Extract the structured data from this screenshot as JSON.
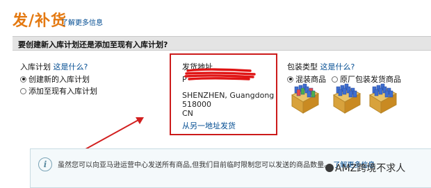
{
  "page": {
    "title": "发/补货",
    "learn_more_link": "了解更多信息",
    "question_header": "要创建新入库计划还是添加至现有入库计划?"
  },
  "inbound_plan": {
    "label": "入库计划",
    "help_link": "这是什么?",
    "options": [
      {
        "label": "创建新的入库计划",
        "selected": true
      },
      {
        "label": "添加至现有入库计划",
        "selected": false
      }
    ]
  },
  "ship_from": {
    "label": "发货地址",
    "name_first_char": "P",
    "address_lines": [
      "SHENZHEN, Guangdong",
      "518000",
      "CN"
    ],
    "change_link": "从另一地址发货"
  },
  "packing_type": {
    "label": "包装类型",
    "help_link": "这是什么?",
    "options": [
      {
        "label": "混装商品",
        "selected": true
      },
      {
        "label": "原厂包装发货商品",
        "selected": false
      }
    ]
  },
  "info_banner": {
    "text": "虽然您可以向亚马逊运营中心发送所有商品,但我们目前临时限制您可以发送的商品数量。",
    "link": "了解更多信息"
  },
  "watermark": {
    "text": "AMZ跨境不求人"
  },
  "colors": {
    "title_orange": "#e47911",
    "link_blue": "#004b91",
    "highlight_red": "#cc1a1a",
    "arrow_red": "#d21f1f",
    "header_gray": "#e4e4e4",
    "info_bg": "#f4f9fb"
  },
  "icons": {
    "annotation": "red-arrow",
    "package_icons": [
      "mixed-box-icon",
      "mixed-box-icon",
      "case-pack-box-icon"
    ],
    "info": "info-icon"
  }
}
